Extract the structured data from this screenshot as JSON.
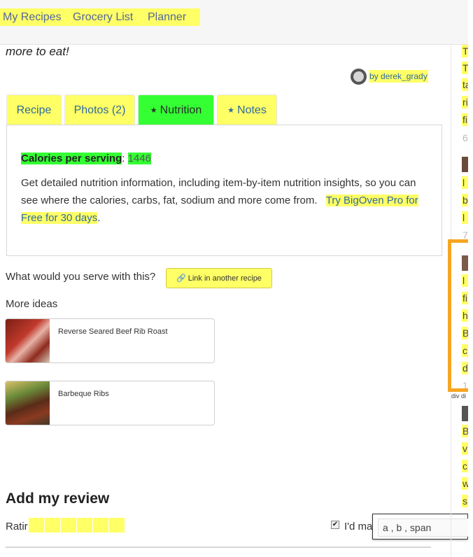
{
  "nav": {
    "items": [
      "My Recipes",
      "Grocery List",
      "Planner"
    ]
  },
  "intro_text": "more to eat!",
  "author": {
    "byline": "by derek_grady"
  },
  "tabs": [
    {
      "label": "Recipe",
      "icon": ""
    },
    {
      "label": "Photos (2)",
      "icon": ""
    },
    {
      "label": "Nutrition",
      "icon": "star-icon"
    },
    {
      "label": "Notes",
      "icon": "star-icon"
    }
  ],
  "nutrition": {
    "calories_label": "Calories per serving",
    "calories_value": "1446",
    "description": "Get detailed nutrition information, including item-by-item nutrition insights, so you can see where the calories, carbs, fat, sodium and more come from.",
    "cta": "Try BigOven Pro for Free for 30 days"
  },
  "serve": {
    "question": "What would you serve with this?",
    "button_label": "Link in another recipe"
  },
  "more_ideas": {
    "heading": "More ideas",
    "items": [
      {
        "title": "Reverse Seared Beef Rib Roast"
      },
      {
        "title": "Barbeque Ribs"
      }
    ]
  },
  "review": {
    "heading": "Add my review",
    "rating_label": "Ratir",
    "checkbox_label": "I'd ma",
    "checkbox_checked": true
  },
  "tooltip": {
    "text": "a , b , span"
  },
  "sidebar": {
    "lines": [
      "T",
      "T",
      "ta",
      "ri",
      "fi",
      "6",
      "l",
      "b",
      "l",
      "7",
      "l",
      "fi",
      "h",
      "B",
      "c",
      "d",
      "1",
      "B",
      "v",
      "c",
      "w",
      "s"
    ],
    "tag": "div di"
  },
  "colors": {
    "highlight_yellow": "#ffff66",
    "highlight_green": "#33ff33",
    "link_blue": "#2e6a9f",
    "focus_orange": "#f5a623"
  }
}
